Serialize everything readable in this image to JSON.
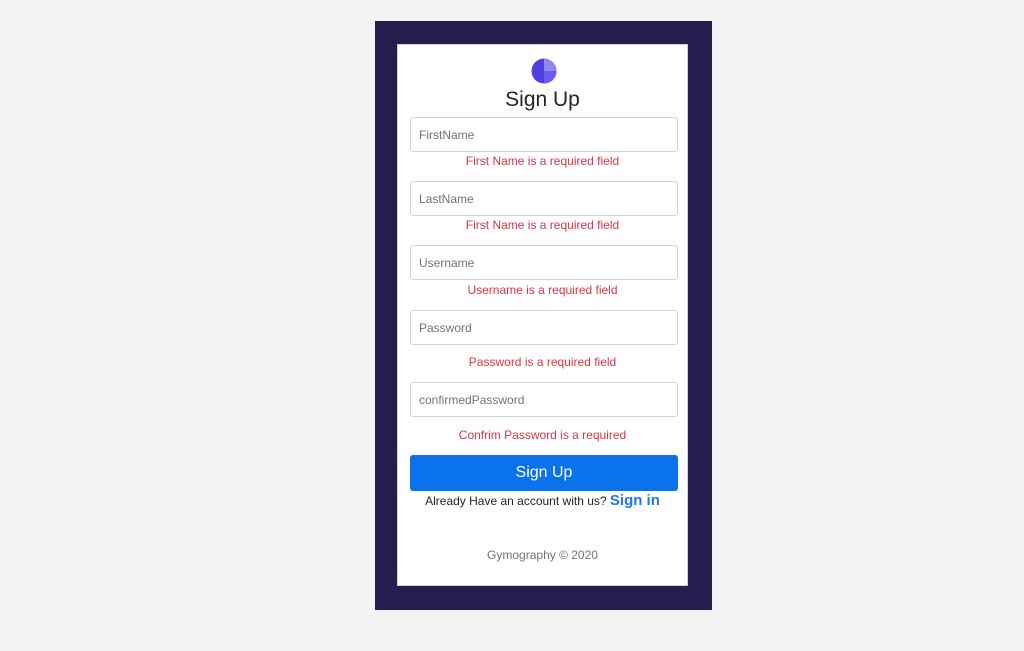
{
  "form": {
    "title": "Sign Up",
    "fields": [
      {
        "placeholder": "FirstName",
        "error": "First Name is a required field"
      },
      {
        "placeholder": "LastName",
        "error": "First Name is a required field"
      },
      {
        "placeholder": "Username",
        "error": "Username is a required field"
      },
      {
        "placeholder": "Password",
        "error": "Password is a required field"
      },
      {
        "placeholder": "confirmedPassword",
        "error": "Confrim Password is a required"
      }
    ],
    "submit_label": "Sign Up",
    "account_prompt": "Already Have an account with us?",
    "signin_label": "Sign in",
    "footer": "Gymography © 2020"
  },
  "icons": {
    "logo": "pie-chart-logo-icon"
  },
  "colors": {
    "frame": "#261c4e",
    "primary": "#0a73ec",
    "error": "#dc3545",
    "logo": "#5b4ee8"
  }
}
